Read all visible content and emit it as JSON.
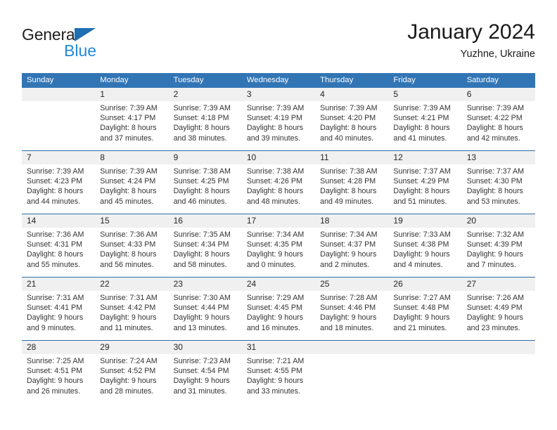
{
  "brand": {
    "name_part1": "General",
    "name_part2": "Blue",
    "accent_color": "#2389d8",
    "triangle_color": "#1f6fb2"
  },
  "header": {
    "month_title": "January 2024",
    "location": "Yuzhne, Ukraine"
  },
  "theme": {
    "header_row_bg": "#3275b5",
    "daynum_band_bg": "#f0f0f0",
    "week_divider": "#2f6ea8",
    "text_color": "#333333"
  },
  "weekdays": [
    "Sunday",
    "Monday",
    "Tuesday",
    "Wednesday",
    "Thursday",
    "Friday",
    "Saturday"
  ],
  "weeks": [
    {
      "days": [
        {
          "num": "",
          "lines": [
            "",
            "",
            "",
            ""
          ],
          "empty": true
        },
        {
          "num": "1",
          "lines": [
            "Sunrise: 7:39 AM",
            "Sunset: 4:17 PM",
            "Daylight: 8 hours",
            "and 37 minutes."
          ]
        },
        {
          "num": "2",
          "lines": [
            "Sunrise: 7:39 AM",
            "Sunset: 4:18 PM",
            "Daylight: 8 hours",
            "and 38 minutes."
          ]
        },
        {
          "num": "3",
          "lines": [
            "Sunrise: 7:39 AM",
            "Sunset: 4:19 PM",
            "Daylight: 8 hours",
            "and 39 minutes."
          ]
        },
        {
          "num": "4",
          "lines": [
            "Sunrise: 7:39 AM",
            "Sunset: 4:20 PM",
            "Daylight: 8 hours",
            "and 40 minutes."
          ]
        },
        {
          "num": "5",
          "lines": [
            "Sunrise: 7:39 AM",
            "Sunset: 4:21 PM",
            "Daylight: 8 hours",
            "and 41 minutes."
          ]
        },
        {
          "num": "6",
          "lines": [
            "Sunrise: 7:39 AM",
            "Sunset: 4:22 PM",
            "Daylight: 8 hours",
            "and 42 minutes."
          ]
        }
      ]
    },
    {
      "days": [
        {
          "num": "7",
          "lines": [
            "Sunrise: 7:39 AM",
            "Sunset: 4:23 PM",
            "Daylight: 8 hours",
            "and 44 minutes."
          ]
        },
        {
          "num": "8",
          "lines": [
            "Sunrise: 7:39 AM",
            "Sunset: 4:24 PM",
            "Daylight: 8 hours",
            "and 45 minutes."
          ]
        },
        {
          "num": "9",
          "lines": [
            "Sunrise: 7:38 AM",
            "Sunset: 4:25 PM",
            "Daylight: 8 hours",
            "and 46 minutes."
          ]
        },
        {
          "num": "10",
          "lines": [
            "Sunrise: 7:38 AM",
            "Sunset: 4:26 PM",
            "Daylight: 8 hours",
            "and 48 minutes."
          ]
        },
        {
          "num": "11",
          "lines": [
            "Sunrise: 7:38 AM",
            "Sunset: 4:28 PM",
            "Daylight: 8 hours",
            "and 49 minutes."
          ]
        },
        {
          "num": "12",
          "lines": [
            "Sunrise: 7:37 AM",
            "Sunset: 4:29 PM",
            "Daylight: 8 hours",
            "and 51 minutes."
          ]
        },
        {
          "num": "13",
          "lines": [
            "Sunrise: 7:37 AM",
            "Sunset: 4:30 PM",
            "Daylight: 8 hours",
            "and 53 minutes."
          ]
        }
      ]
    },
    {
      "days": [
        {
          "num": "14",
          "lines": [
            "Sunrise: 7:36 AM",
            "Sunset: 4:31 PM",
            "Daylight: 8 hours",
            "and 55 minutes."
          ]
        },
        {
          "num": "15",
          "lines": [
            "Sunrise: 7:36 AM",
            "Sunset: 4:33 PM",
            "Daylight: 8 hours",
            "and 56 minutes."
          ]
        },
        {
          "num": "16",
          "lines": [
            "Sunrise: 7:35 AM",
            "Sunset: 4:34 PM",
            "Daylight: 8 hours",
            "and 58 minutes."
          ]
        },
        {
          "num": "17",
          "lines": [
            "Sunrise: 7:34 AM",
            "Sunset: 4:35 PM",
            "Daylight: 9 hours",
            "and 0 minutes."
          ]
        },
        {
          "num": "18",
          "lines": [
            "Sunrise: 7:34 AM",
            "Sunset: 4:37 PM",
            "Daylight: 9 hours",
            "and 2 minutes."
          ]
        },
        {
          "num": "19",
          "lines": [
            "Sunrise: 7:33 AM",
            "Sunset: 4:38 PM",
            "Daylight: 9 hours",
            "and 4 minutes."
          ]
        },
        {
          "num": "20",
          "lines": [
            "Sunrise: 7:32 AM",
            "Sunset: 4:39 PM",
            "Daylight: 9 hours",
            "and 7 minutes."
          ]
        }
      ]
    },
    {
      "days": [
        {
          "num": "21",
          "lines": [
            "Sunrise: 7:31 AM",
            "Sunset: 4:41 PM",
            "Daylight: 9 hours",
            "and 9 minutes."
          ]
        },
        {
          "num": "22",
          "lines": [
            "Sunrise: 7:31 AM",
            "Sunset: 4:42 PM",
            "Daylight: 9 hours",
            "and 11 minutes."
          ]
        },
        {
          "num": "23",
          "lines": [
            "Sunrise: 7:30 AM",
            "Sunset: 4:44 PM",
            "Daylight: 9 hours",
            "and 13 minutes."
          ]
        },
        {
          "num": "24",
          "lines": [
            "Sunrise: 7:29 AM",
            "Sunset: 4:45 PM",
            "Daylight: 9 hours",
            "and 16 minutes."
          ]
        },
        {
          "num": "25",
          "lines": [
            "Sunrise: 7:28 AM",
            "Sunset: 4:46 PM",
            "Daylight: 9 hours",
            "and 18 minutes."
          ]
        },
        {
          "num": "26",
          "lines": [
            "Sunrise: 7:27 AM",
            "Sunset: 4:48 PM",
            "Daylight: 9 hours",
            "and 21 minutes."
          ]
        },
        {
          "num": "27",
          "lines": [
            "Sunrise: 7:26 AM",
            "Sunset: 4:49 PM",
            "Daylight: 9 hours",
            "and 23 minutes."
          ]
        }
      ]
    },
    {
      "days": [
        {
          "num": "28",
          "lines": [
            "Sunrise: 7:25 AM",
            "Sunset: 4:51 PM",
            "Daylight: 9 hours",
            "and 26 minutes."
          ]
        },
        {
          "num": "29",
          "lines": [
            "Sunrise: 7:24 AM",
            "Sunset: 4:52 PM",
            "Daylight: 9 hours",
            "and 28 minutes."
          ]
        },
        {
          "num": "30",
          "lines": [
            "Sunrise: 7:23 AM",
            "Sunset: 4:54 PM",
            "Daylight: 9 hours",
            "and 31 minutes."
          ]
        },
        {
          "num": "31",
          "lines": [
            "Sunrise: 7:21 AM",
            "Sunset: 4:55 PM",
            "Daylight: 9 hours",
            "and 33 minutes."
          ]
        },
        {
          "num": "",
          "lines": [
            "",
            "",
            "",
            ""
          ],
          "empty": true
        },
        {
          "num": "",
          "lines": [
            "",
            "",
            "",
            ""
          ],
          "empty": true
        },
        {
          "num": "",
          "lines": [
            "",
            "",
            "",
            ""
          ],
          "empty": true
        }
      ]
    }
  ]
}
